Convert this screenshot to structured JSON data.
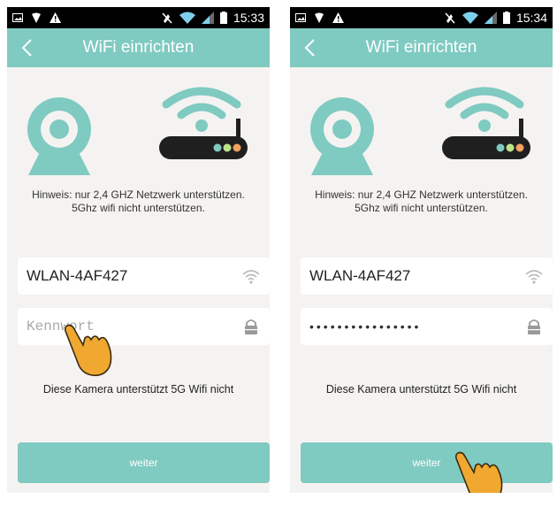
{
  "left": {
    "status_time": "15:33",
    "title": "WiFi einrichten",
    "hint_line1": "Hinweis: nur 2,4 GHZ Netzwerk unterstützen.",
    "hint_line2": "5Ghz wifi nicht unterstützen.",
    "ssid_value": "WLAN-4AF427",
    "password_placeholder": "Kennwort",
    "note": "Diese Kamera unterstützt 5G Wifi nicht",
    "button_label": "weiter"
  },
  "right": {
    "status_time": "15:34",
    "title": "WiFi einrichten",
    "hint_line1": "Hinweis: nur 2,4 GHZ Netzwerk unterstützen.",
    "hint_line2": "5Ghz wifi nicht unterstützen.",
    "ssid_value": "WLAN-4AF427",
    "password_masked": "••••••••••••••••",
    "note": "Diese Kamera unterstützt 5G Wifi nicht",
    "button_label": "weiter"
  },
  "icons": {
    "status_left": [
      "image-icon",
      "location-icon",
      "warning-icon"
    ],
    "status_right": [
      "mute-icon",
      "wifi-signal-icon",
      "cell-signal-icon",
      "battery-icon"
    ],
    "back": "back-arrow-icon",
    "camera": "webcam-icon",
    "router": "router-icon",
    "ssid_field": "wifi-icon",
    "password_field": "lock-icon",
    "gesture": "tap-hand-icon"
  },
  "colors": {
    "accent": "#7fcac1",
    "illustration_teal": "#7fcac1",
    "router_body": "#1f1f1f",
    "hand": "#f0a830"
  }
}
